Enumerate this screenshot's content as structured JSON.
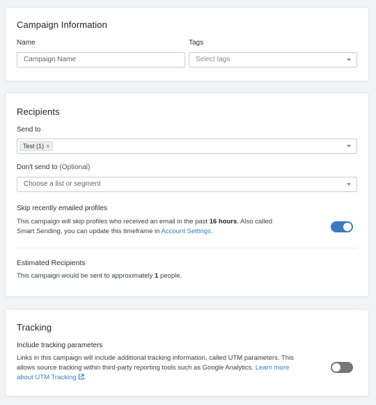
{
  "campaign_info": {
    "title": "Campaign Information",
    "name_label": "Name",
    "name_placeholder": "Campaign Name",
    "tags_label": "Tags",
    "tags_placeholder": "Select tags"
  },
  "recipients": {
    "title": "Recipients",
    "send_to_label": "Send to",
    "send_to_chip": "Test (1)",
    "chip_remove": "×",
    "dont_send_label": "Don't send to",
    "dont_send_optional": "(Optional)",
    "dont_send_placeholder": "Choose a list or segment",
    "skip_title": "Skip recently emailed profiles",
    "skip_text_1": "This campaign will skip profiles who received an email in the past ",
    "skip_hours": "16 hours",
    "skip_text_2": ". Also called",
    "skip_text_3": "Smart Sending, you can update this timeframe in ",
    "skip_link": "Account Settings",
    "skip_text_4": ".",
    "skip_enabled": true,
    "estimated_title": "Estimated Recipients",
    "estimated_text_1": "This campaign would be sent to approximately ",
    "estimated_count": "1",
    "estimated_text_2": " people."
  },
  "tracking": {
    "title": "Tracking",
    "include_title": "Include tracking parameters",
    "line_1": "Links in this campaign will include additional tracking information, called UTM parameters. This",
    "line_2a": "allows source tracking within third-party reporting tools such as Google Analytics. ",
    "link_a": "Learn more",
    "link_b": "about UTM Tracking",
    "line_3_end": ".",
    "enabled": false
  },
  "colors": {
    "accent": "#3a7bbf",
    "link": "#2f7fc1",
    "toggle_off": "#73767c"
  },
  "icons": {
    "caret": "chevron-down-icon",
    "external": "external-link-icon"
  }
}
